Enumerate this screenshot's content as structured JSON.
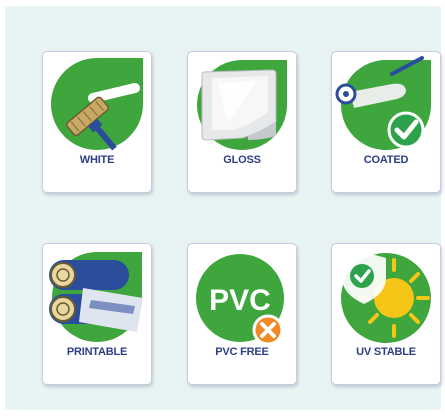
{
  "colors": {
    "green": "#3fa63e",
    "blue": "#2b4e9c",
    "label": "#2c3f85",
    "orange": "#f08a24",
    "sun": "#f5c518",
    "panel": "#e8f4f3"
  },
  "badges": [
    {
      "label": "WHITE",
      "icon": "paint-roller-icon"
    },
    {
      "label": "GLOSS",
      "icon": "gloss-sheet-icon"
    },
    {
      "label": "COATED",
      "icon": "coating-check-icon"
    },
    {
      "label": "PRINTABLE",
      "icon": "printer-rollers-icon"
    },
    {
      "label": "PVC FREE",
      "icon": "pvc-free-icon",
      "icon_text": "PVC"
    },
    {
      "label": "UV STABLE",
      "icon": "sun-shield-icon"
    }
  ]
}
